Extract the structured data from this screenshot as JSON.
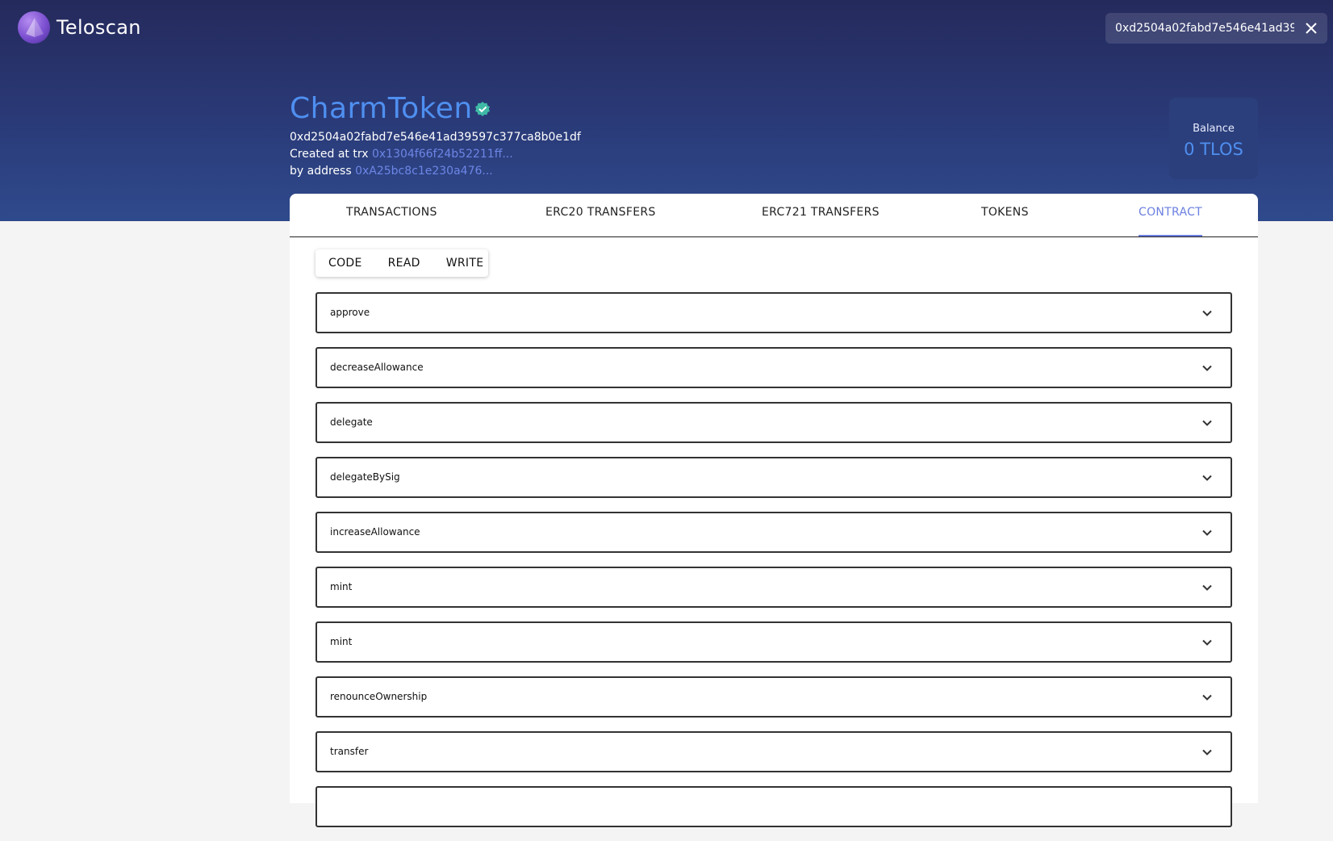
{
  "header": {
    "app_name": "Teloscan",
    "search_value": "0xd2504a02fabd7e546e41ad39597c377ca8b0e1df",
    "icons": [
      "telos-logo-icon",
      "close-icon"
    ]
  },
  "token": {
    "name": "CharmToken",
    "address": "0xd2504a02fabd7e546e41ad39597c377ca8b0e1df",
    "created_prefix": "Created at trx",
    "created_trx": "0x1304f66f24b52211ff...",
    "by_prefix": "by address",
    "by_address": "0xA25bc8c1e230a476...",
    "verified_icon": "verified-check-icon"
  },
  "balance": {
    "label": "Balance",
    "value": "0 TLOS"
  },
  "tabs": [
    {
      "label": "TRANSACTIONS"
    },
    {
      "label": "ERC20 TRANSFERS"
    },
    {
      "label": "ERC721 TRANSFERS"
    },
    {
      "label": "TOKENS"
    },
    {
      "label": "CONTRACT",
      "active": true
    }
  ],
  "subtabs": [
    {
      "label": "CODE"
    },
    {
      "label": "READ"
    },
    {
      "label": "WRITE"
    }
  ],
  "functions": [
    {
      "name": "approve"
    },
    {
      "name": "decreaseAllowance"
    },
    {
      "name": "delegate"
    },
    {
      "name": "delegateBySig"
    },
    {
      "name": "increaseAllowance"
    },
    {
      "name": "mint"
    },
    {
      "name": "mint"
    },
    {
      "name": "renounceOwnership"
    },
    {
      "name": "transfer"
    },
    {
      "name": ""
    }
  ],
  "colors": {
    "accent": "#4f8ff0",
    "tab_active": "#6b7fe0",
    "link": "#6d86e6",
    "hero_top": "#252a5c",
    "hero_bottom": "#2f4a8c"
  }
}
